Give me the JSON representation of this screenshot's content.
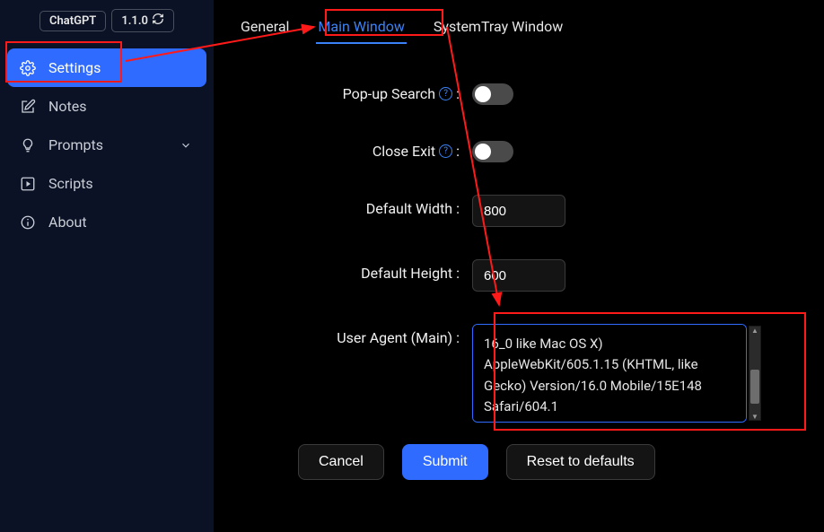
{
  "topbar": {
    "app_name": "ChatGPT",
    "version": "1.1.0"
  },
  "sidebar": {
    "items": [
      {
        "label": "Settings"
      },
      {
        "label": "Notes"
      },
      {
        "label": "Prompts"
      },
      {
        "label": "Scripts"
      },
      {
        "label": "About"
      }
    ]
  },
  "tabs": {
    "general": "General",
    "main_window": "Main Window",
    "system_tray": "SystemTray Window"
  },
  "form": {
    "popup_search_label": "Pop-up Search",
    "close_exit_label": "Close Exit",
    "default_width_label": "Default Width",
    "default_width_value": "800",
    "default_height_label": "Default Height",
    "default_height_value": "600",
    "user_agent_label": "User Agent (Main)",
    "user_agent_value": "16_0 like Mac OS X) AppleWebKit/605.1.15 (KHTML, like Gecko) Version/16.0 Mobile/15E148 Safari/604.1",
    "colon": ":"
  },
  "actions": {
    "cancel": "Cancel",
    "submit": "Submit",
    "reset": "Reset to defaults"
  }
}
